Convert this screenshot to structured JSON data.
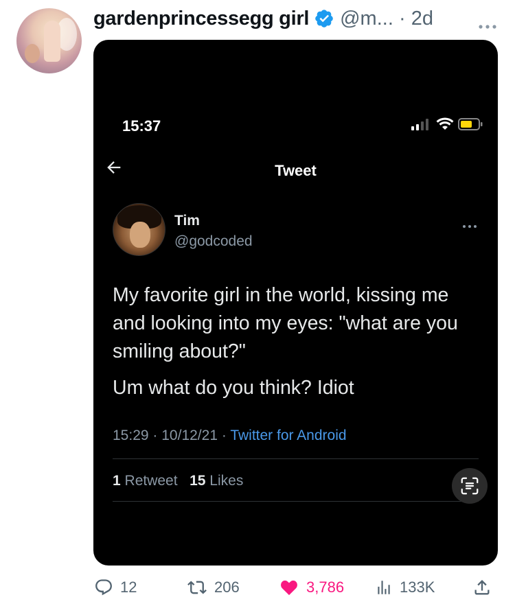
{
  "post": {
    "display_name": "gardenprincessegg girl",
    "handle": "@m...",
    "separator": "·",
    "age": "2d",
    "more_icon": "more-horizontal-icon"
  },
  "screenshot": {
    "status_time": "15:37",
    "title": "Tweet",
    "author_name": "Tim",
    "author_handle": "@godcoded",
    "body_paragraphs": [
      "My favorite girl in the world, kissing me and looking into my eyes: \"what are you smiling about?\"",
      "Um what do you think? Idiot"
    ],
    "time": "15:29",
    "date": "10/12/21",
    "dot": "·",
    "source": "Twitter for Android",
    "retweet_count": "1",
    "retweet_label": "Retweet",
    "like_count": "15",
    "like_label": "Likes"
  },
  "actions": {
    "replies": "12",
    "reposts": "206",
    "likes": "3,786",
    "views": "133K"
  },
  "colors": {
    "verified_blue": "#1d9bf0",
    "like_pink": "#f91880",
    "link_blue": "#4a99e9",
    "muted": "#536471"
  }
}
